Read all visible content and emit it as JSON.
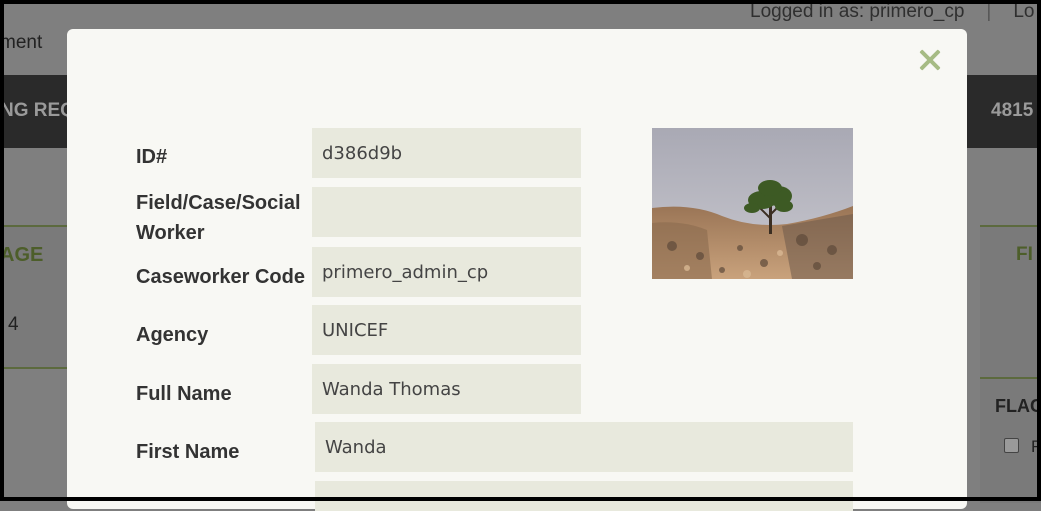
{
  "background": {
    "logged_in": "Logged in as: primero_cp",
    "logout_partial": "Lo",
    "menu_partial": "ment",
    "bar_left_partial": "NG REQ",
    "bar_right_partial": "4815",
    "table_header_partial": "AGE",
    "table_cell_partial": "4",
    "right_header_partial": "FI",
    "flag_header_partial": "FLAG",
    "flag_option_partial": "F"
  },
  "modal": {
    "close_label": "×",
    "fields": [
      {
        "label": "ID#",
        "value": "d386d9b"
      },
      {
        "label": "Field/Case/Social Worker",
        "value": ""
      },
      {
        "label": "Caseworker Code",
        "value": "primero_admin_cp"
      },
      {
        "label": "Agency",
        "value": "UNICEF"
      },
      {
        "label": "Full Name",
        "value": "Wanda Thomas"
      },
      {
        "label": "First Name",
        "value": "Wanda"
      }
    ],
    "photo_alt": "tree-landscape-photo"
  },
  "colors": {
    "accent": "#a6bb84",
    "field_bg": "#e8e9dd",
    "modal_bg": "#f8f8f4",
    "dark_bar": "#2a2a2a"
  }
}
